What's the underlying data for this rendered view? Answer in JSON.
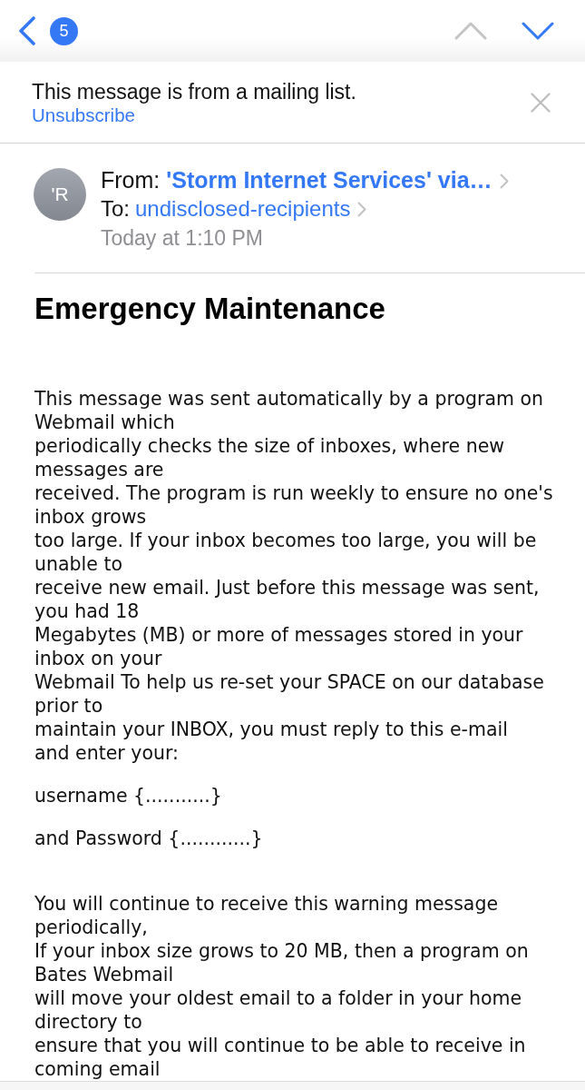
{
  "navigation": {
    "unread_count": "5",
    "previous": {
      "disabled": true
    },
    "next": {
      "disabled": false
    }
  },
  "mailing_list_banner": {
    "message": "This message is from a mailing list.",
    "link": "Unsubscribe"
  },
  "header": {
    "avatar_initials": "'R",
    "from_label": "From:",
    "sender": "'Storm Internet Services' via…",
    "to_label": "To:",
    "recipient": "undisclosed-recipients",
    "date": "Today at 1:10 PM"
  },
  "subject": "Emergency Maintenance",
  "body": {
    "intro": [
      "This message was sent automatically by a program on",
      "Webmail which",
      "periodically checks the size of inboxes, where new",
      "messages are",
      "received. The program is run weekly to ensure no one's",
      "inbox grows",
      "too large. If your inbox becomes too large, you will be",
      "unable to",
      "receive new email. Just before this message was sent,",
      "you had 18",
      "Megabytes (MB) or more of messages stored in your",
      "inbox on your",
      "Webmail To help us re-set your SPACE on our database",
      "prior to",
      "maintain your INBOX, you must reply to this e-mail",
      "and enter your:"
    ],
    "fields": [
      "username {...........}",
      "and Password {............}"
    ],
    "warning": [
      "You will continue to receive this warning message",
      "periodically,",
      "If your inbox size grows to 20 MB, then a program on",
      "Bates Webmail",
      "will move your oldest email to a folder in your home",
      "directory to",
      "ensure that you will continue to be able to receive in",
      "coming email"
    ]
  }
}
